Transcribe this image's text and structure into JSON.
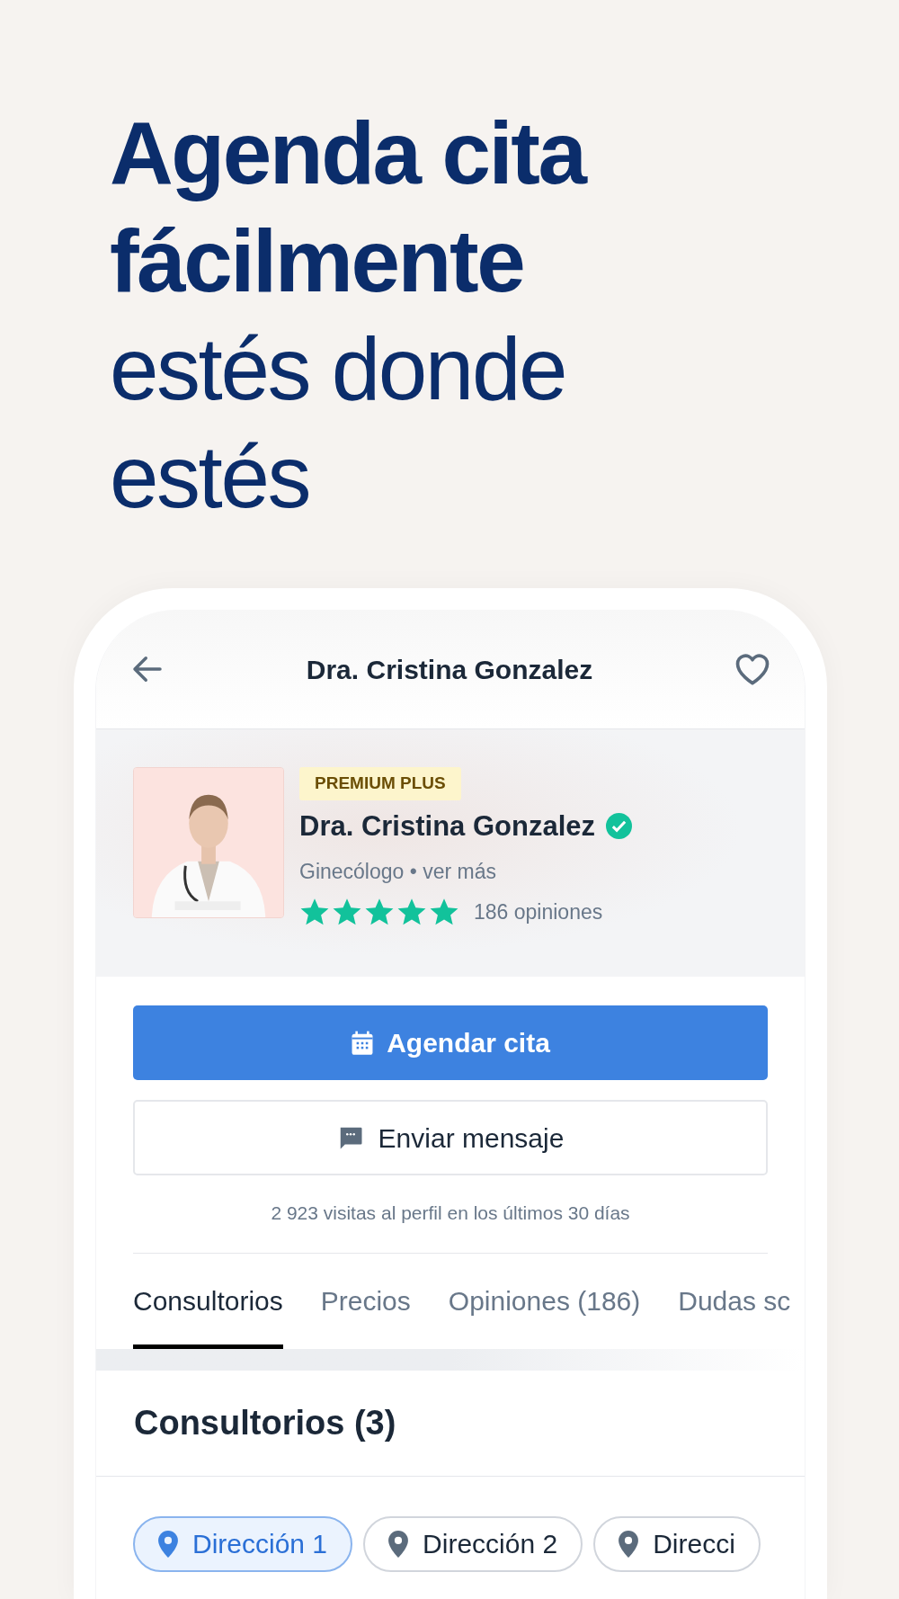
{
  "headline": "**Agenda cita fácilmente** estés donde estés",
  "header": {
    "title": "Dra. Cristina Gonzalez"
  },
  "profile": {
    "badge": "PREMIUM PLUS",
    "name": "Dra. Cristina Gonzalez",
    "verified": true,
    "specialty": "Ginecólogo • ver más",
    "stars": 5,
    "reviews": "186 opiniones"
  },
  "buttons": [
    {
      "kind": "primary",
      "label": "Agendar cita"
    },
    {
      "kind": "secondary",
      "label": "Enviar mensaje"
    }
  ],
  "visits": "2 923 visitas al perfil en los últimos 30 días",
  "tabs": [
    {
      "label": "Consultorios",
      "selected": true
    },
    {
      "label": "Precios",
      "selected": false
    },
    {
      "label": "Opiniones (186)",
      "selected": false
    },
    {
      "label": "Dudas sc",
      "selected": false
    }
  ],
  "section_title": "Consultorios (3)",
  "addresses": [
    {
      "label": "Dirección 1",
      "selected": true
    },
    {
      "label": "Dirección 2",
      "selected": false
    },
    {
      "label": "Direcci",
      "selected": false
    }
  ]
}
